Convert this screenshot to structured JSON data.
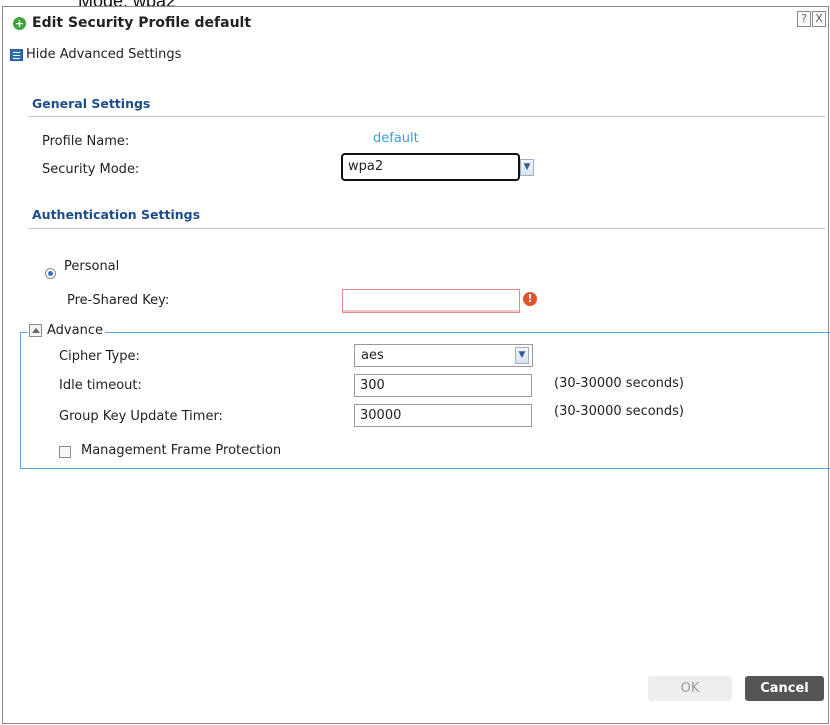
{
  "top_partial_text": "Mode: wpa2",
  "dialog": {
    "title": "Edit Security Profile default",
    "help_icon": "?",
    "close_icon": "X",
    "hide_advanced_label": "Hide Advanced Settings"
  },
  "general": {
    "heading": "General Settings",
    "profile_name_label": "Profile Name:",
    "profile_name_value": "default",
    "security_mode_label": "Security Mode:",
    "security_mode_value": "wpa2"
  },
  "auth": {
    "heading": "Authentication Settings",
    "personal_label": "Personal",
    "psk_label": "Pre-Shared Key:",
    "psk_value": ""
  },
  "advance": {
    "legend": "Advance",
    "cipher_label": "Cipher Type:",
    "cipher_value": "aes",
    "idle_label": "Idle timeout:",
    "idle_value": "300",
    "idle_hint": "(30-30000 seconds)",
    "gk_label": "Group Key Update Timer:",
    "gk_value": "30000",
    "gk_hint": "(30-30000 seconds)",
    "mfp_label": "Management Frame Protection"
  },
  "footer": {
    "ok_label": "OK",
    "cancel_label": "Cancel"
  },
  "colors": {
    "heading_blue": "#1c4d8a",
    "link_blue": "#3aa0d8",
    "fieldset_border": "#58a8de",
    "error_red": "#e0532e",
    "cancel_bg": "#555555"
  }
}
